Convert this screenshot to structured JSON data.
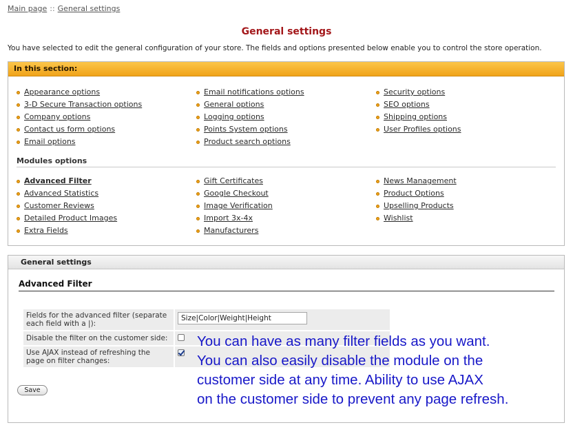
{
  "breadcrumb": {
    "home": "Main page",
    "separator": "::",
    "current": "General settings"
  },
  "page_title": "General settings",
  "intro": "You have selected to edit the general configuration of your store. The fields and options presented below enable you to control the store operation.",
  "section": {
    "header": "In this section:",
    "options_col1": [
      "Appearance options",
      "3-D Secure Transaction options",
      "Company options",
      "Contact us form options",
      "Email options"
    ],
    "options_col2": [
      "Email notifications options",
      "General options",
      "Logging options",
      "Points System options",
      "Product search options"
    ],
    "options_col3": [
      "Security options",
      "SEO options",
      "Shipping options",
      "User Profiles options"
    ],
    "modules_title": "Modules options",
    "modules_col1": [
      "Advanced Filter",
      "Advanced Statistics",
      "Customer Reviews",
      "Detailed Product Images",
      "Extra Fields"
    ],
    "modules_col2": [
      "Gift Certificates",
      "Google Checkout",
      "Image Verification",
      "Import 3x-4x",
      "Manufacturers"
    ],
    "modules_col3": [
      "News Management",
      "Product Options",
      "Upselling Products",
      "Wishlist"
    ]
  },
  "general_settings": {
    "header": "General settings",
    "subtitle": "Advanced Filter",
    "fields": {
      "filter_fields_label": "Fields for the advanced filter (separate each field with a |):",
      "filter_fields_value": "Size|Color|Weight|Height",
      "disable_label": "Disable the filter on the customer side:",
      "disable_checked": false,
      "ajax_label": "Use AJAX instead of refreshing the page on filter changes:",
      "ajax_checked": true
    },
    "save_label": "Save"
  },
  "annotation": {
    "line1": "You can have as many filter fields as you want.",
    "line2": "You can also easily disable the module on the",
    "line3": "customer side at any time.  Ability to use AJAX",
    "line4": "on the customer side to prevent any page refresh."
  },
  "colors": {
    "title": "#a3171a",
    "section_header": "#f0a31a",
    "annotation": "#1818c8"
  }
}
